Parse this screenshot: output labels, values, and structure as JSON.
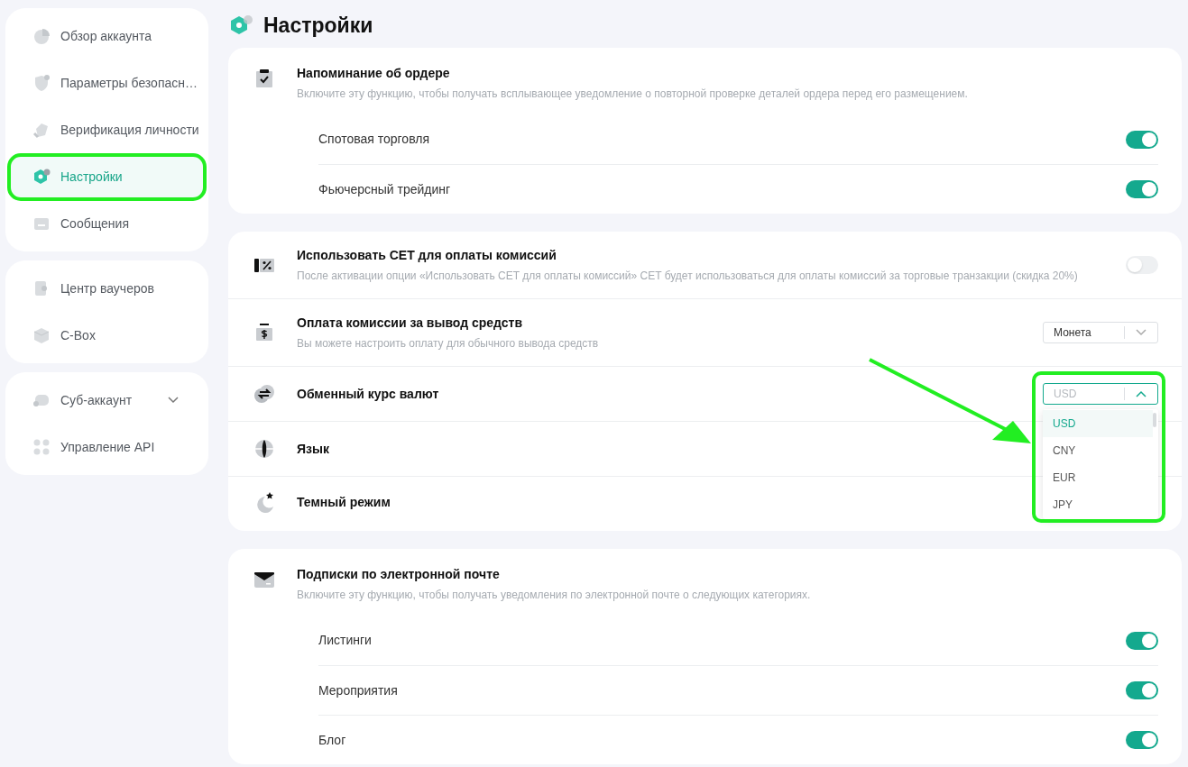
{
  "sidebar": {
    "groups": [
      {
        "items": [
          {
            "label": "Обзор аккаунта",
            "selected": false,
            "highlighted": false
          },
          {
            "label": "Параметры безопасн…",
            "selected": false,
            "highlighted": false
          },
          {
            "label": "Верификация личности",
            "selected": false,
            "highlighted": false
          },
          {
            "label": "Настройки",
            "selected": true,
            "highlighted": true
          },
          {
            "label": "Сообщения",
            "selected": false,
            "highlighted": false
          }
        ]
      },
      {
        "items": [
          {
            "label": "Центр ваучеров",
            "selected": false,
            "highlighted": false
          },
          {
            "label": "C-Box",
            "selected": false,
            "highlighted": false
          }
        ]
      },
      {
        "items": [
          {
            "label": "Суб-аккаунт",
            "selected": false,
            "highlighted": false,
            "expanded": false
          },
          {
            "label": "Управление API",
            "selected": false,
            "highlighted": false
          }
        ]
      }
    ]
  },
  "page_title": "Настройки",
  "cards": [
    {
      "rows": [
        {
          "kind": "header",
          "title": "Напоминание об ордере",
          "description": "Включите эту функцию, чтобы получать всплывающее уведомление о повторной проверке деталей ордера перед его размещением."
        },
        {
          "kind": "toggle",
          "label": "Спотовая торговля",
          "on": true
        },
        {
          "kind": "toggle",
          "label": "Фьючерсный трейдинг",
          "on": true
        }
      ]
    },
    {
      "rows": [
        {
          "kind": "setting",
          "title": "Использовать CET для оплаты комиссий",
          "description": "После активации опции «Использовать CET для оплаты комиссий» CET будет использоваться для оплаты комиссий за торговые транзакции (скидка 20%)",
          "control": {
            "kind": "toggle",
            "on": false
          }
        },
        {
          "kind": "setting",
          "title": "Оплата комиссии за вывод средств",
          "description": "Вы можете настроить оплату для обычного вывода средств",
          "control": {
            "kind": "select",
            "value": "Монета",
            "expanded": false
          }
        },
        {
          "kind": "setting",
          "title": "Обменный курс валют",
          "control": {
            "kind": "select",
            "placeholder": "USD",
            "expanded": true,
            "highlighted": true,
            "options": [
              {
                "label": "USD",
                "selected": true
              },
              {
                "label": "CNY",
                "selected": false
              },
              {
                "label": "EUR",
                "selected": false
              },
              {
                "label": "JPY",
                "selected": false
              }
            ]
          }
        },
        {
          "kind": "setting",
          "title": "Язык"
        },
        {
          "kind": "setting",
          "title": "Темный режим"
        }
      ]
    },
    {
      "rows": [
        {
          "kind": "header",
          "title": "Подписки по электронной почте",
          "description": "Включите эту функцию, чтобы получать уведомления по электронной почте о следующих категориях."
        },
        {
          "kind": "toggle",
          "label": "Листинги",
          "on": true
        },
        {
          "kind": "toggle",
          "label": "Мероприятия",
          "on": true
        },
        {
          "kind": "toggle",
          "label": "Блог",
          "on": true
        }
      ]
    }
  ],
  "annotation_arrow": true
}
